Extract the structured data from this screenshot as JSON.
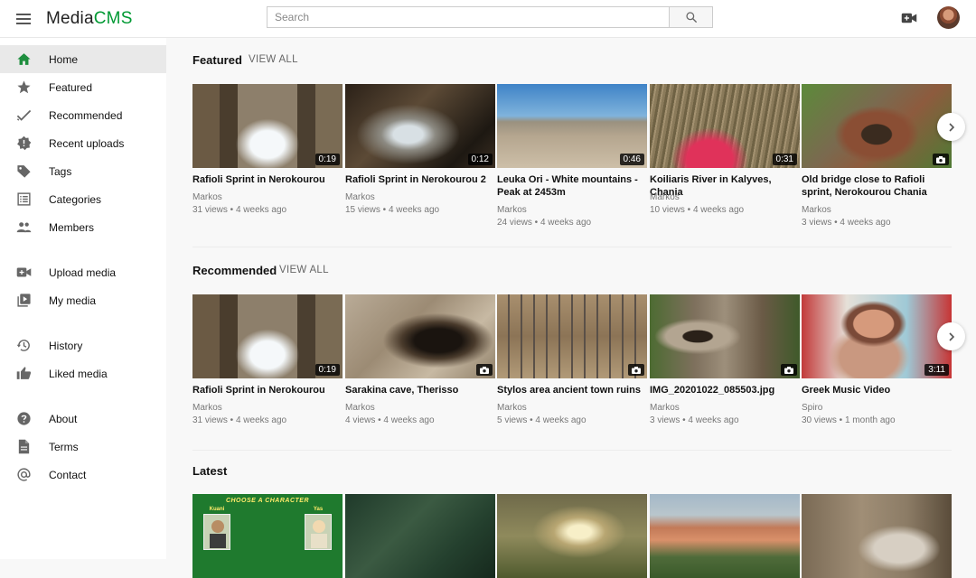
{
  "header": {
    "logo_part1": "Media",
    "logo_part2": "CMS",
    "search_placeholder": "Search",
    "icons": [
      "menu-icon",
      "search-icon",
      "upload-video-icon",
      "avatar"
    ]
  },
  "sidebar": {
    "items": [
      {
        "label": "Home",
        "icon": "home-icon",
        "active": true
      },
      {
        "label": "Featured",
        "icon": "star-icon"
      },
      {
        "label": "Recommended",
        "icon": "check-icon"
      },
      {
        "label": "Recent uploads",
        "icon": "new-badge-icon"
      },
      {
        "label": "Tags",
        "icon": "tag-icon"
      },
      {
        "label": "Categories",
        "icon": "list-icon"
      },
      {
        "label": "Members",
        "icon": "people-icon"
      },
      {
        "label": "Upload media",
        "icon": "video-add-icon"
      },
      {
        "label": "My media",
        "icon": "video-library-icon"
      },
      {
        "label": "History",
        "icon": "history-icon"
      },
      {
        "label": "Liked media",
        "icon": "thumb-up-icon"
      },
      {
        "label": "About",
        "icon": "help-icon"
      },
      {
        "label": "Terms",
        "icon": "document-icon"
      },
      {
        "label": "Contact",
        "icon": "at-icon"
      }
    ]
  },
  "sections": {
    "featured": {
      "title": "Featured",
      "view_all": "VIEW ALL",
      "items": [
        {
          "title": "Rafioli Sprint in Nerokourou",
          "author": "Markos",
          "meta": "31 views • 4 weeks ago",
          "duration": "0:19"
        },
        {
          "title": "Rafioli Sprint in Nerokourou 2",
          "author": "Markos",
          "meta": "15 views • 4 weeks ago",
          "duration": "0:12"
        },
        {
          "title": "Leuka Ori - White mountains - Peak at 2453m",
          "author": "Markos",
          "meta": "24 views • 4 weeks ago",
          "duration": "0:46"
        },
        {
          "title": "Koiliaris River in Kalyves, Chania",
          "author": "Markos",
          "meta": "10 views • 4 weeks ago",
          "duration": "0:31"
        },
        {
          "title": "Old bridge close to Rafioli sprint, Nerokourou Chania",
          "author": "Markos",
          "meta": "3 views • 4 weeks ago",
          "duration": ""
        }
      ]
    },
    "recommended": {
      "title": "Recommended",
      "view_all": "VIEW ALL",
      "items": [
        {
          "title": "Rafioli Sprint in Nerokourou",
          "author": "Markos",
          "meta": "31 views • 4 weeks ago",
          "duration": "0:19"
        },
        {
          "title": "Sarakina cave, Therisso",
          "author": "Markos",
          "meta": "4 views • 4 weeks ago",
          "duration": ""
        },
        {
          "title": "Stylos area ancient town ruins",
          "author": "Markos",
          "meta": "5 views • 4 weeks ago",
          "duration": ""
        },
        {
          "title": "IMG_20201022_085503.jpg",
          "author": "Markos",
          "meta": "3 views • 4 weeks ago",
          "duration": ""
        },
        {
          "title": "Greek Music Video",
          "author": "Spiro",
          "meta": "30 views • 1 month ago",
          "duration": "3:11"
        }
      ]
    },
    "latest": {
      "title": "Latest",
      "thumb_text": {
        "line1": "CHOOSE A CHARACTER",
        "left_name": "Kuani",
        "right_name": "Yas"
      }
    }
  },
  "colors": {
    "brand_green": "#009933",
    "active_bg": "#e9e9e9",
    "page_bg": "#f8f8f8"
  }
}
